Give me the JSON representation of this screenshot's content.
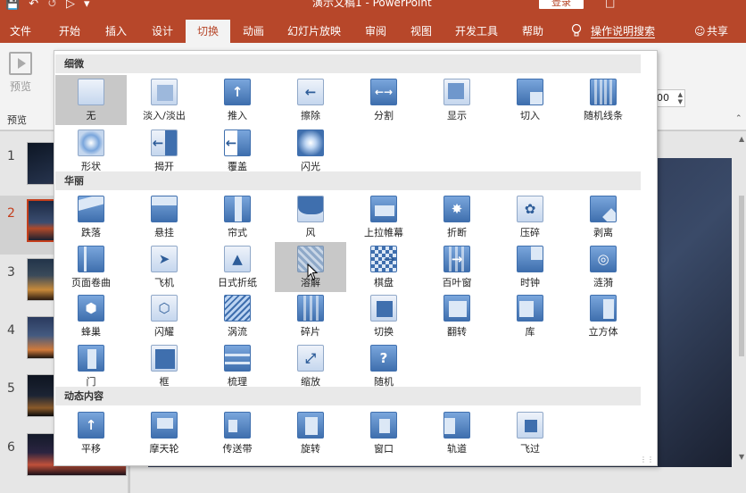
{
  "titlebar": {
    "title": "演示文稿1 - PowerPoint",
    "login": "登录",
    "qat": [
      "save-icon",
      "undo-icon",
      "redo-icon",
      "preview-from-start-icon",
      "customize-icon"
    ]
  },
  "tabs": [
    "文件",
    "开始",
    "插入",
    "设计",
    "切换",
    "动画",
    "幻灯片放映",
    "审阅",
    "视图",
    "开发工具",
    "帮助"
  ],
  "active_tab": "切换",
  "tellme": "操作说明搜索",
  "share": "共享",
  "ribbon": {
    "preview_label": "预览",
    "preview_group": "预览",
    "duration_value": "00"
  },
  "slides": [
    "1",
    "2",
    "3",
    "4",
    "5",
    "6"
  ],
  "selected_slide": "2",
  "gallery": {
    "sections": [
      {
        "title": "细微",
        "items": [
          "无",
          "淡入/淡出",
          "推入",
          "擦除",
          "分割",
          "显示",
          "切入",
          "随机线条",
          "形状",
          "揭开",
          "覆盖",
          "闪光"
        ]
      },
      {
        "title": "华丽",
        "items": [
          "跌落",
          "悬挂",
          "帘式",
          "风",
          "上拉帷幕",
          "折断",
          "压碎",
          "剥离",
          "页面卷曲",
          "飞机",
          "日式折纸",
          "溶解",
          "棋盘",
          "百叶窗",
          "时钟",
          "涟漪",
          "蜂巢",
          "闪耀",
          "涡流",
          "碎片",
          "切换",
          "翻转",
          "库",
          "立方体",
          "门",
          "框",
          "梳理",
          "缩放",
          "随机"
        ]
      },
      {
        "title": "动态内容",
        "items": [
          "平移",
          "摩天轮",
          "传送带",
          "旋转",
          "窗口",
          "轨道",
          "飞过"
        ]
      }
    ],
    "hovered_item": "溶解",
    "selected_item": "无"
  },
  "colors": {
    "accent": "#b7472a",
    "tile_blue": "#3f6fae",
    "hover_gray": "#c8c8c8"
  }
}
